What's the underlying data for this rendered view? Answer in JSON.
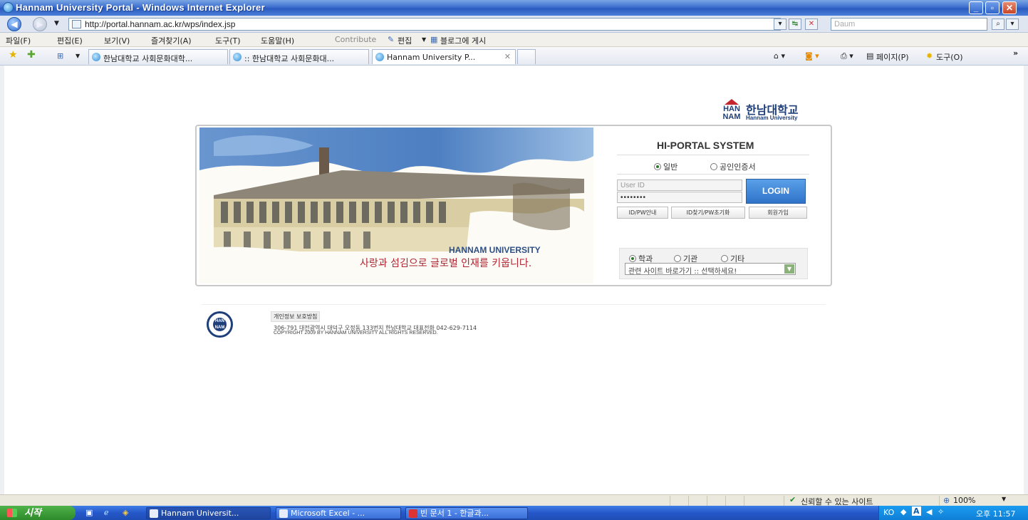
{
  "window": {
    "title": "Hannam University Portal - Windows Internet Explorer"
  },
  "addressbar": {
    "url": "http://portal.hannam.ac.kr/wps/index.jsp",
    "search_placeholder": "Daum"
  },
  "menubar": {
    "items": [
      "파일(F)",
      "편집(E)",
      "보기(V)",
      "즐겨찾기(A)",
      "도구(T)",
      "도움말(H)"
    ],
    "contribute": "Contribute",
    "edit": "편집",
    "blog_post": "블로그에 게시"
  },
  "tabs": [
    {
      "label": "한남대학교 사회문화대학..."
    },
    {
      "label": ":: 한남대학교 사회문화대..."
    },
    {
      "label": "Hannam University P..."
    }
  ],
  "toolbar_right": {
    "page": "페이지(P)",
    "tools": "도구(O)"
  },
  "logo": {
    "mark_top": "HAN",
    "mark_bottom": "NAM",
    "name": "한남대학교",
    "sub": "Hannam University"
  },
  "banner": {
    "university": "HANNAM UNIVERSITY",
    "slogan": "사랑과 섬김으로 글로벌 인재를 키웁니다."
  },
  "login": {
    "title": "HI-PORTAL SYSTEM",
    "radio_general": "일반",
    "radio_cert": "공인인증서",
    "userid_placeholder": "User ID",
    "password_mask": "••••••••",
    "login_button": "LOGIN",
    "btn_id_pw_guide": "ID/PW안내",
    "btn_find": "ID찾기/PW초기화",
    "btn_join": "회원가입"
  },
  "sites": {
    "radio_dept": "학과",
    "radio_org": "기관",
    "radio_etc": "기타",
    "select_value": "관련 사이트 바로가기 :: 선택하세요!"
  },
  "footer": {
    "seal_top": "HAN",
    "seal_bottom": "NAM",
    "privacy": "개인정보 보호방침",
    "address": "306-791 대전광역시 대덕구 오정동 133번지 한남대학교  대표전화 042-629-7114",
    "copyright": "COPYRIGHT 2009 BY HANNAM UNIVERSITY ALL RIGHTS RESERVED."
  },
  "statusbar": {
    "zone": "신뢰할 수 있는 사이트",
    "zoom": "100%"
  },
  "taskbar": {
    "start": "시작",
    "tasks": [
      {
        "label": "Hannam Universit..."
      },
      {
        "label": "Microsoft Excel - ..."
      },
      {
        "label": "빈 문서 1 - 한글과..."
      }
    ],
    "lang": "KO",
    "clock": "오후 11:57"
  },
  "colors": {
    "login_button": "#2f73c9",
    "slogan_red": "#b02532",
    "brand_navy": "#1f3f7a",
    "titlebar": "#2a5bc0",
    "taskbar": "#2557c8"
  }
}
